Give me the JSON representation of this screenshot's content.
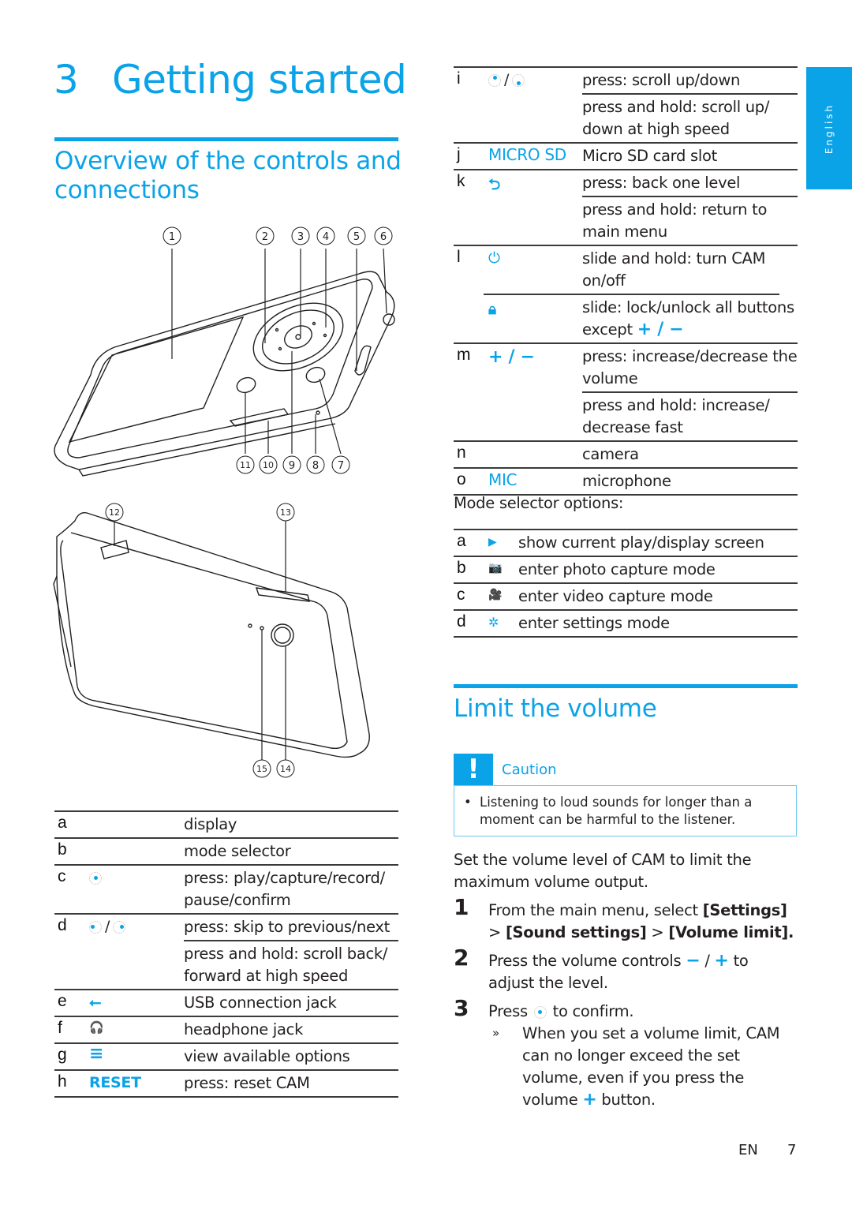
{
  "chapter": {
    "number": "3",
    "title": "Getting started"
  },
  "section_overview": {
    "title": "Overview of the controls and connections"
  },
  "side_tab": {
    "label": "English"
  },
  "diagram_front": {
    "callouts": [
      "1",
      "2",
      "3",
      "4",
      "5",
      "6",
      "7",
      "8",
      "9",
      "10",
      "11"
    ]
  },
  "diagram_back": {
    "callouts": [
      "12",
      "13",
      "14",
      "15"
    ]
  },
  "controls_left": [
    {
      "letter": "a",
      "icon": "",
      "descs": [
        "display"
      ]
    },
    {
      "letter": "b",
      "icon": "",
      "descs": [
        "mode selector"
      ]
    },
    {
      "letter": "c",
      "icon": "nav-center-icon",
      "descs": [
        "press: play/capture/record/ pause/confirm"
      ]
    },
    {
      "letter": "d",
      "icon": "nav-left-right-icon",
      "descs": [
        "press: skip to previous/next",
        "press and hold: scroll back/ forward at high speed"
      ]
    },
    {
      "letter": "e",
      "icon": "usb-icon",
      "descs": [
        "USB connection jack"
      ]
    },
    {
      "letter": "f",
      "icon": "headphone-icon",
      "descs": [
        "headphone jack"
      ]
    },
    {
      "letter": "g",
      "icon": "menu-icon",
      "descs": [
        "view available options"
      ]
    },
    {
      "letter": "h",
      "icon_text": "RESET",
      "descs": [
        "press: reset CAM"
      ]
    }
  ],
  "controls_right": [
    {
      "letter": "i",
      "icon": "nav-up-down-icon",
      "descs": [
        "press: scroll up/down",
        "press and hold: scroll up/ down at high speed"
      ]
    },
    {
      "letter": "j",
      "icon_text": "MICRO SD",
      "descs": [
        "Micro SD card slot"
      ]
    },
    {
      "letter": "k",
      "icon": "back-icon",
      "descs": [
        "press: back one level",
        "press and hold: return to main menu"
      ]
    },
    {
      "letter": "l",
      "icon": "power-icon",
      "descs": [
        "slide and hold: turn CAM on/off"
      ],
      "sub_icon": "lock-icon",
      "sub_desc": "slide: lock/unlock all buttons except",
      "sub_desc_suffix": "+ / −"
    },
    {
      "letter": "m",
      "icon_text": "+ / −",
      "descs": [
        "press: increase/decrease the volume",
        "press and hold: increase/ decrease fast"
      ]
    },
    {
      "letter": "n",
      "icon": "",
      "descs": [
        "camera"
      ]
    },
    {
      "letter": "o",
      "icon_text": "MIC",
      "descs": [
        "microphone"
      ]
    }
  ],
  "mode_selector": {
    "intro": "Mode selector options:",
    "items": [
      {
        "letter": "a",
        "icon": "play-icon",
        "glyph": "▶",
        "desc": "show current play/display screen"
      },
      {
        "letter": "b",
        "icon": "camera-icon",
        "glyph": "📷",
        "desc": "enter photo capture mode"
      },
      {
        "letter": "c",
        "icon": "video-camera-icon",
        "glyph": "🎥",
        "desc": "enter video capture mode"
      },
      {
        "letter": "d",
        "icon": "settings-gear-icon",
        "glyph": "✲",
        "desc": "enter settings mode"
      }
    ]
  },
  "section_volume": {
    "title": "Limit the volume",
    "caution": {
      "label": "Caution",
      "mark": "!",
      "bullet": "Listening to loud sounds for longer than a moment can be harmful to the listener."
    },
    "intro": "Set the volume level of CAM to limit the maximum volume output.",
    "steps": [
      {
        "num": "1",
        "text_pre": "From the main menu, select ",
        "bold1": "[Settings]",
        "mid1": " > ",
        "bold2": "[Sound settings]",
        "mid2": " > ",
        "bold3": "[Volume limit]."
      },
      {
        "num": "2",
        "text_pre": "Press the volume controls ",
        "minus": "−",
        "sep": " / ",
        "plus": "+",
        "text_post": " to adjust the level."
      },
      {
        "num": "3",
        "text_pre": "Press ",
        "text_post": " to confirm.",
        "result_marker": "»",
        "result": "When you set a volume limit, CAM can no longer exceed the set volume, even if you press the volume",
        "result_plus": "+",
        "result_end": "button."
      }
    ]
  },
  "footer": {
    "lang": "EN",
    "page": "7"
  },
  "colors": {
    "accent": "#0ba3e8",
    "text": "#231f20",
    "rule": "#3a3a3a"
  }
}
